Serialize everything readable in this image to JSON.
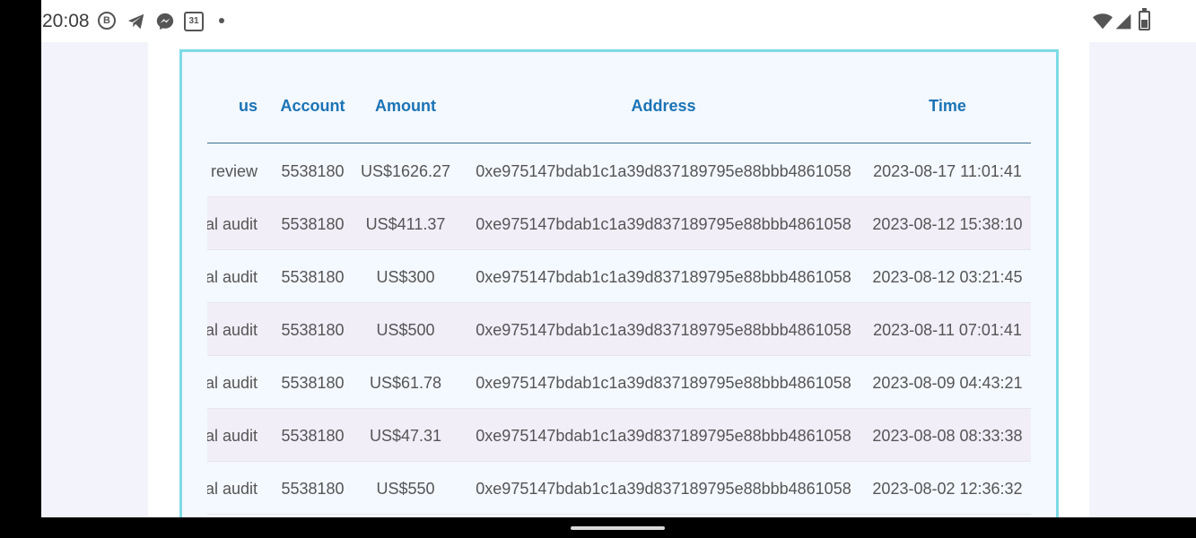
{
  "status_bar": {
    "time": "20:08",
    "left_icons": [
      "b-circle-icon",
      "telegram-icon",
      "messenger-icon",
      "calendar-icon",
      "dot-icon"
    ],
    "calendar_day": "31",
    "b_badge": "B",
    "right_icons": [
      "wifi-icon",
      "signal-icon",
      "battery-icon"
    ]
  },
  "table": {
    "columns": {
      "status": "us",
      "account": "Account",
      "amount": "Amount",
      "address": "Address",
      "time": "Time"
    },
    "rows": [
      {
        "status": "review",
        "account": "5538180",
        "amount": "US$1626.27",
        "address": "0xe975147bdab1c1a39d837189795e88bbb4861058",
        "time": "2023-08-17 11:01:41"
      },
      {
        "status": "al audit",
        "account": "5538180",
        "amount": "US$411.37",
        "address": "0xe975147bdab1c1a39d837189795e88bbb4861058",
        "time": "2023-08-12 15:38:10"
      },
      {
        "status": "al audit",
        "account": "5538180",
        "amount": "US$300",
        "address": "0xe975147bdab1c1a39d837189795e88bbb4861058",
        "time": "2023-08-12 03:21:45"
      },
      {
        "status": "al audit",
        "account": "5538180",
        "amount": "US$500",
        "address": "0xe975147bdab1c1a39d837189795e88bbb4861058",
        "time": "2023-08-11 07:01:41"
      },
      {
        "status": "al audit",
        "account": "5538180",
        "amount": "US$61.78",
        "address": "0xe975147bdab1c1a39d837189795e88bbb4861058",
        "time": "2023-08-09 04:43:21"
      },
      {
        "status": "al audit",
        "account": "5538180",
        "amount": "US$47.31",
        "address": "0xe975147bdab1c1a39d837189795e88bbb4861058",
        "time": "2023-08-08 08:33:38"
      },
      {
        "status": "al audit",
        "account": "5538180",
        "amount": "US$550",
        "address": "0xe975147bdab1c1a39d837189795e88bbb4861058",
        "time": "2023-08-02 12:36:32"
      }
    ]
  },
  "colors": {
    "header_text": "#1a73b5",
    "panel_border": "#7ddbe6",
    "alt_row": "#f1eef8"
  }
}
